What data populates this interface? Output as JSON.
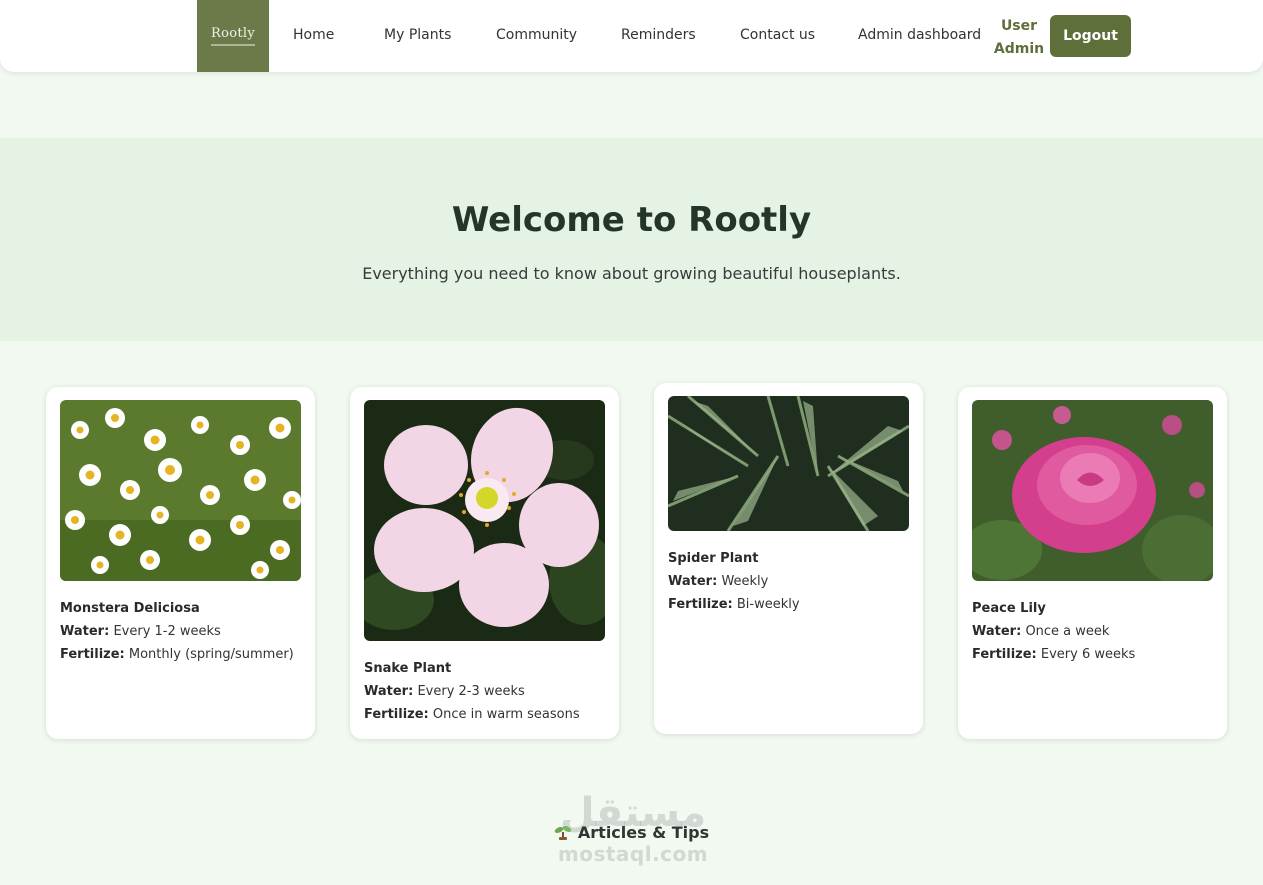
{
  "nav": {
    "logo_text": "Rootly",
    "links": [
      "Home",
      "My Plants",
      "Community",
      "Reminders",
      "Contact us",
      "Admin dashboard"
    ],
    "user_label": "User",
    "role_label": "Admin",
    "logout_label": "Logout"
  },
  "hero": {
    "title": "Welcome to Rootly",
    "subtitle": "Everything you need to know about growing beautiful houseplants."
  },
  "plants": [
    {
      "name": "Monstera Deliciosa",
      "water_label": "Water:",
      "water": "Every 1-2 weeks",
      "fertilize_label": "Fertilize:",
      "fertilize": "Monthly (spring/summer)",
      "image": "white-daisies-photo"
    },
    {
      "name": "Snake Plant",
      "water_label": "Water:",
      "water": "Every 2-3 weeks",
      "fertilize_label": "Fertilize:",
      "fertilize": "Once in warm seasons",
      "image": "pink-wild-rose-photo"
    },
    {
      "name": "Spider Plant",
      "water_label": "Water:",
      "water": "Weekly",
      "fertilize_label": "Fertilize:",
      "fertilize": "Bi-weekly",
      "image": "fern-leaves-photo"
    },
    {
      "name": "Peace Lily",
      "water_label": "Water:",
      "water": "Once a week",
      "fertilize_label": "Fertilize:",
      "fertilize": "Every 6 weeks",
      "image": "pink-rose-photo"
    }
  ],
  "articles": {
    "icon": "sprout-icon",
    "title": "Articles & Tips"
  },
  "watermark": {
    "arabic": "مستقل",
    "latin": "mostaql.com"
  },
  "colors": {
    "brand": "#5f6f3a",
    "page_bg": "#f1f9f1",
    "hero_bg": "#e4f3e3"
  }
}
